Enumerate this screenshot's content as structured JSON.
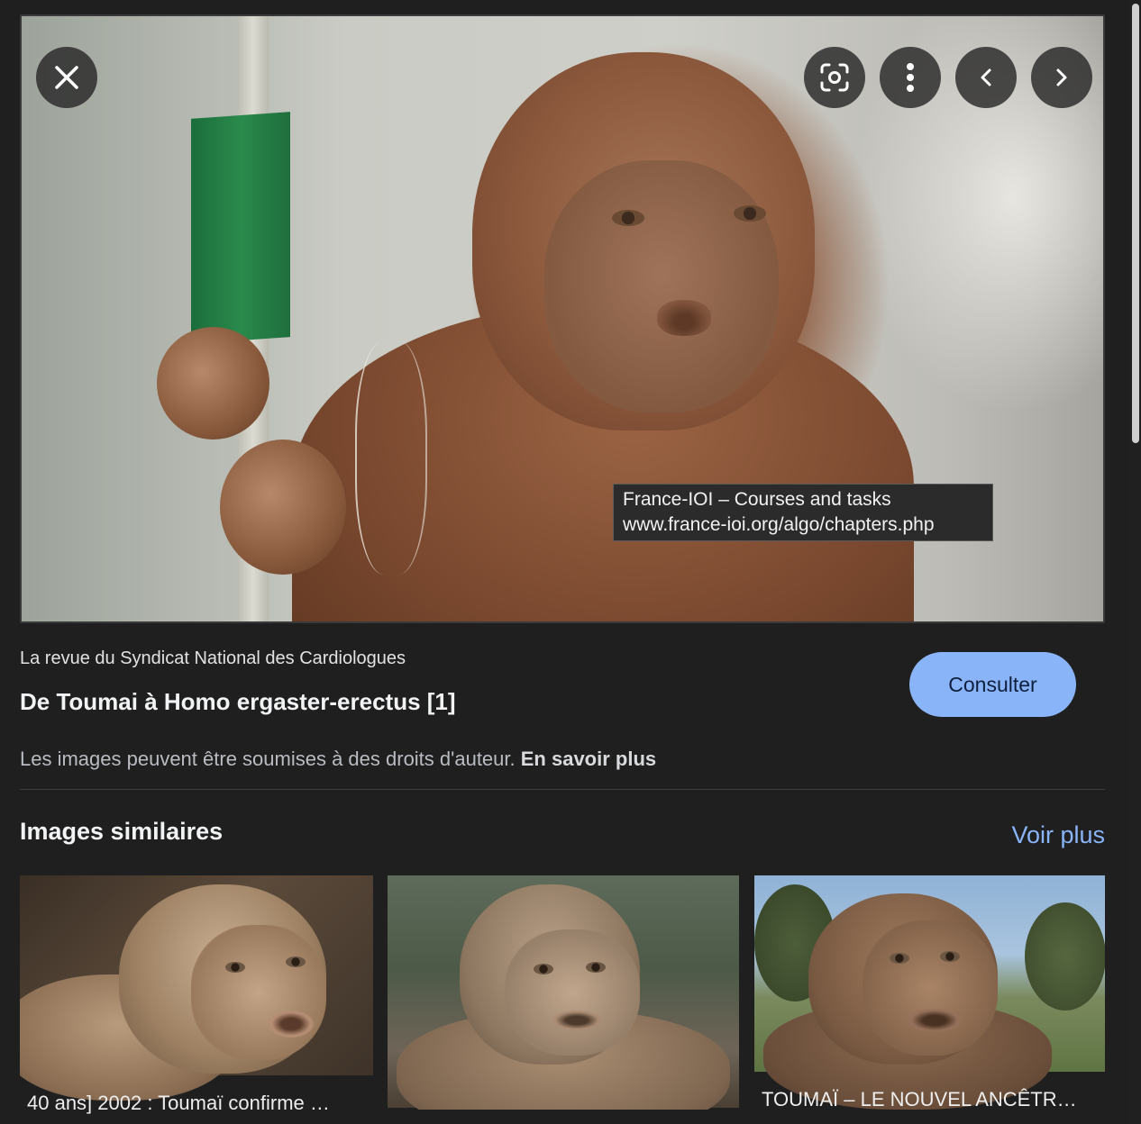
{
  "preview": {
    "controls": {
      "close": "close-icon",
      "lens": "lens-search-icon",
      "more": "more-vertical-icon",
      "prev": "chevron-left-icon",
      "next": "chevron-right-icon"
    },
    "tooltip": {
      "line1": "France-IOI – Courses and tasks",
      "line2": "www.france-ioi.org/algo/chapters.php"
    }
  },
  "result": {
    "source": "La revue du Syndicat National des Cardiologues",
    "title": "De Toumai à Homo ergaster-erectus [1]",
    "consult_label": "Consulter",
    "copyright_text": "Les images peuvent être soumises à des droits d'auteur.",
    "learn_more": "En savoir plus"
  },
  "similar": {
    "heading": "Images similaires",
    "see_more": "Voir plus",
    "items": [
      {
        "caption": "40 ans] 2002 : Toumaï confirme …"
      },
      {
        "caption": ""
      },
      {
        "caption": "TOUMAÏ – LE NOUVEL ANCÊTR…"
      }
    ]
  },
  "colors": {
    "background": "#1f1f1f",
    "accent": "#8ab4f8",
    "text": "#e8eaed"
  }
}
